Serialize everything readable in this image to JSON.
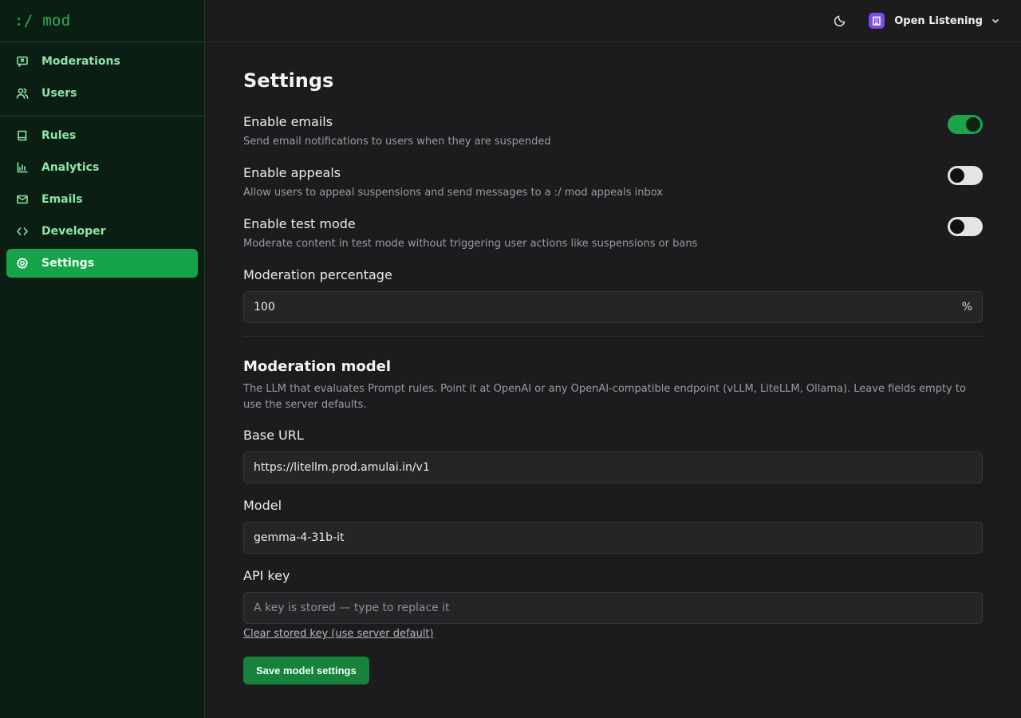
{
  "app": {
    "logo": ":/ mod"
  },
  "sidebar": {
    "group1": [
      {
        "label": "Moderations",
        "icon": "flag-message-icon"
      },
      {
        "label": "Users",
        "icon": "users-icon"
      }
    ],
    "group2": [
      {
        "label": "Rules",
        "icon": "book-icon"
      },
      {
        "label": "Analytics",
        "icon": "chart-icon"
      },
      {
        "label": "Emails",
        "icon": "mail-icon"
      },
      {
        "label": "Developer",
        "icon": "code-icon"
      },
      {
        "label": "Settings",
        "icon": "gear-icon",
        "active": true
      }
    ]
  },
  "topbar": {
    "theme_icon": "moon-icon",
    "workspace_name": "Open Listening"
  },
  "settings": {
    "title": "Settings",
    "toggles": [
      {
        "title": "Enable emails",
        "desc": "Send email notifications to users when they are suspended",
        "on": true
      },
      {
        "title": "Enable appeals",
        "desc": "Allow users to appeal suspensions and send messages to a :/ mod appeals inbox",
        "on": false
      },
      {
        "title": "Enable test mode",
        "desc": "Moderate content in test mode without triggering user actions like suspensions or bans",
        "on": false
      }
    ],
    "moderation_percentage": {
      "label": "Moderation percentage",
      "value": "100",
      "suffix": "%"
    }
  },
  "model": {
    "title": "Moderation model",
    "desc": "The LLM that evaluates Prompt rules. Point it at OpenAI or any OpenAI-compatible endpoint (vLLM, LiteLLM, Ollama). Leave fields empty to use the server defaults.",
    "base_url": {
      "label": "Base URL",
      "value": "https://litellm.prod.amulai.in/v1"
    },
    "model": {
      "label": "Model",
      "value": "gemma-4-31b-it"
    },
    "api_key": {
      "label": "API key",
      "placeholder": "A key is stored — type to replace it"
    },
    "clear_link": "Clear stored key (use server default)",
    "save_label": "Save model settings"
  },
  "colors": {
    "accent": "#17a34a",
    "sidebar_bg": "#0b1e14",
    "page_bg": "#1c1c1e"
  }
}
